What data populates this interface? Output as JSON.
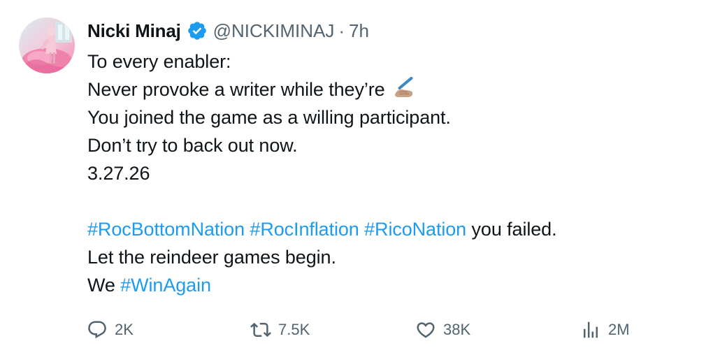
{
  "author": {
    "name": "Nicki Minaj",
    "handle": "@NICKIMINAJ",
    "separator": "·",
    "time": "7h",
    "verified": true
  },
  "tweet": {
    "lines": [
      "To every enabler:",
      "Never provoke a writer while they’re",
      "You joined the game as a willing participant.",
      "Don’t try to back out now.",
      "3.27.26",
      "",
      "you failed.",
      "Let the reindeer games begin.",
      "We"
    ],
    "hashtags": [
      "#RocBottomNation",
      "#RocInflation",
      "#RicoNation",
      "#WinAgain"
    ],
    "emoji": "writing-hand-emoji"
  },
  "actions": {
    "replies": "2K",
    "reposts": "7.5K",
    "likes": "38K",
    "views": "2M"
  },
  "colors": {
    "text": "#0f1419",
    "muted": "#536471",
    "link": "#1d9bf0",
    "verified": "#1d9bf0"
  }
}
